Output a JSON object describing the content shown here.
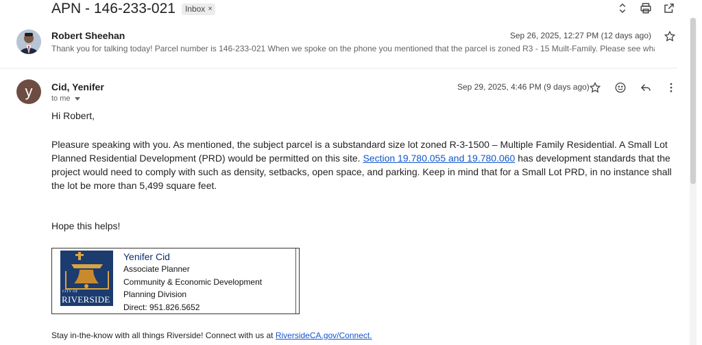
{
  "thread": {
    "subject": "APN - 146-233-021",
    "label": "Inbox",
    "label_remove": "×"
  },
  "message1": {
    "sender": "Robert Sheehan",
    "date": "Sep 26, 2025, 12:27 PM (12 days ago)",
    "snippet": "Thank you for talking today! Parcel number is 146-233-021 When we spoke on the phone you mentioned that the parcel is zoned R3 - 15 Muilt-Family. Please see wha"
  },
  "message2": {
    "avatar_letter": "y",
    "sender": "Cid, Yenifer",
    "recipient": "to me",
    "date": "Sep 29, 2025, 4:46 PM (9 days ago)",
    "greeting": "Hi Robert,",
    "para_a": "Pleasure speaking with you. As mentioned, the subject parcel is a substandard size lot zoned R-3-1500 – Multiple Family Residential.  A Small Lot Planned Residential Development (PRD) would be permitted on this site. ",
    "link": "Section 19.780.055 and 19.780.060",
    "para_b": " has development standards that the project would need to comply with such as density, setbacks, open space, and parking. Keep in mind that for a Small Lot PRD, in no instance shall the lot be more than 5,499 square feet.",
    "closing": "Hope this helps!"
  },
  "signature": {
    "logo_city": "CITY OF",
    "logo_name": "RIVERSIDE",
    "name": "Yenifer Cid",
    "title": "Associate Planner",
    "department": "Community & Economic Development",
    "division": "Planning Division",
    "direct_label": "Direct:",
    "direct_number": "951.826.5652"
  },
  "footer": {
    "text": "Stay in-the-know with all things Riverside! Connect with us at ",
    "link": "RiversideCA.gov/Connect."
  },
  "icons": [
    "expand-collapse-icon",
    "print-icon",
    "open-new-window-icon",
    "star-icon",
    "emoji-icon",
    "reply-icon",
    "more-vert-icon"
  ],
  "colors": {
    "link": "#1155cc",
    "avatar_y": "#6d4c41",
    "logo_bg": "#1c3b6e"
  }
}
